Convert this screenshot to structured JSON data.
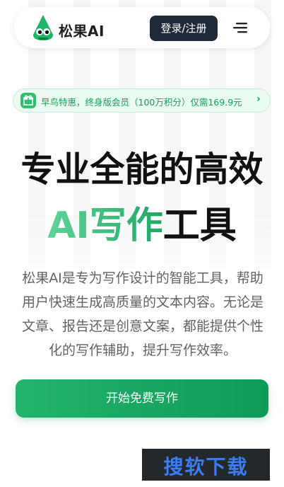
{
  "header": {
    "brand": "松果AI",
    "login_label": "登录/注册",
    "menu_icon": "hamburger-menu-icon",
    "logo_icon": "pinecone-mascot-icon"
  },
  "promo": {
    "icon": "gift-icon",
    "text": "早鸟特惠，终身版会员（100万积分）仅需169.9元",
    "chevron": "›"
  },
  "hero": {
    "title_line1": "专业全能的高效",
    "title_line2_highlight": "AI写作",
    "title_line2_rest": "工具",
    "description": "松果AI是专为写作设计的智能工具，帮助用户快速生成高质量的文本内容。无论是文章、报告还是创意文案，都能提供个性化的写作辅助，提升写作效率。"
  },
  "cta": {
    "label": "开始免费写作"
  },
  "watermark": {
    "text": "搜软下载"
  },
  "colors": {
    "accent_green": "#22a765",
    "dark_button": "#1f2937",
    "promo_bg": "#eafbf2"
  }
}
